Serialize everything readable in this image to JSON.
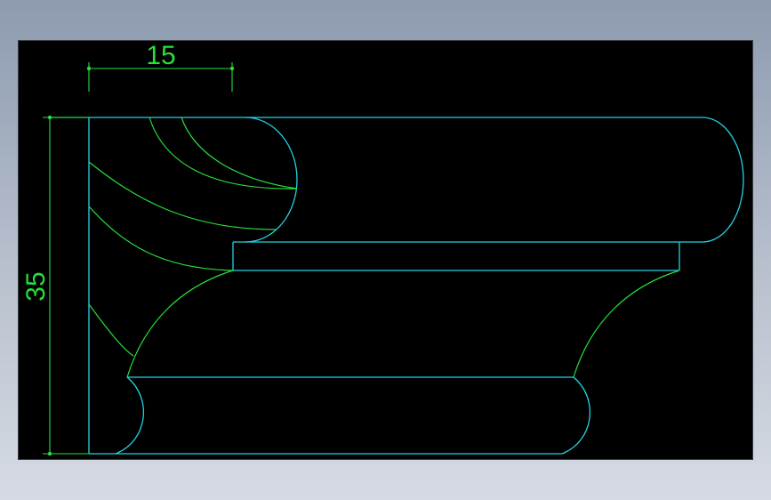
{
  "colors": {
    "outline": "#22d3e6",
    "detail": "#27e03a",
    "dimension": "#27e03a",
    "background": "#000000"
  },
  "dimensions": {
    "horizontal": {
      "value": "15"
    },
    "vertical": {
      "value": "35"
    }
  }
}
